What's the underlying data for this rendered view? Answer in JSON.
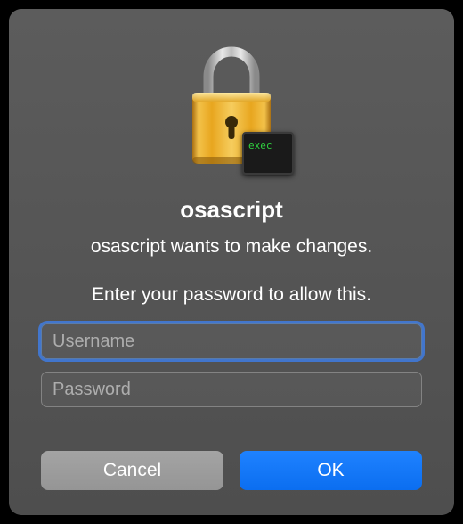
{
  "dialog": {
    "title": "osascript",
    "message": "osascript wants to make changes.",
    "prompt": "Enter your password to allow this.",
    "username_placeholder": "Username",
    "password_placeholder": "Password",
    "username_value": "",
    "password_value": "",
    "cancel_label": "Cancel",
    "ok_label": "OK"
  },
  "icon": {
    "lock": "lock-icon",
    "badge": "terminal-exec-icon",
    "badge_text": "exec"
  }
}
